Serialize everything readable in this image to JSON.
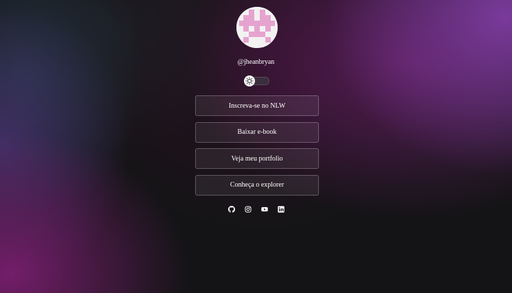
{
  "profile": {
    "username": "@jheanbryan",
    "avatar_colors": {
      "background": "#f2f2f2",
      "pattern": "#e6a3d0"
    }
  },
  "theme_switch": {
    "icon": "sun-icon",
    "state": "off"
  },
  "links": [
    {
      "label": "Inscreva-se no NLW"
    },
    {
      "label": "Baixar e-book"
    },
    {
      "label": "Veja meu portfolio"
    },
    {
      "label": "Conheça o explorer"
    }
  ],
  "socials": [
    {
      "icon": "github-icon"
    },
    {
      "icon": "instagram-icon"
    },
    {
      "icon": "youtube-icon"
    },
    {
      "icon": "linkedin-icon"
    }
  ],
  "colors": {
    "page_background": "#141416",
    "glow_purple": "#7d3ca0",
    "glow_magenta": "#781e6e",
    "button_border": "rgba(255,255,255,0.25)"
  }
}
